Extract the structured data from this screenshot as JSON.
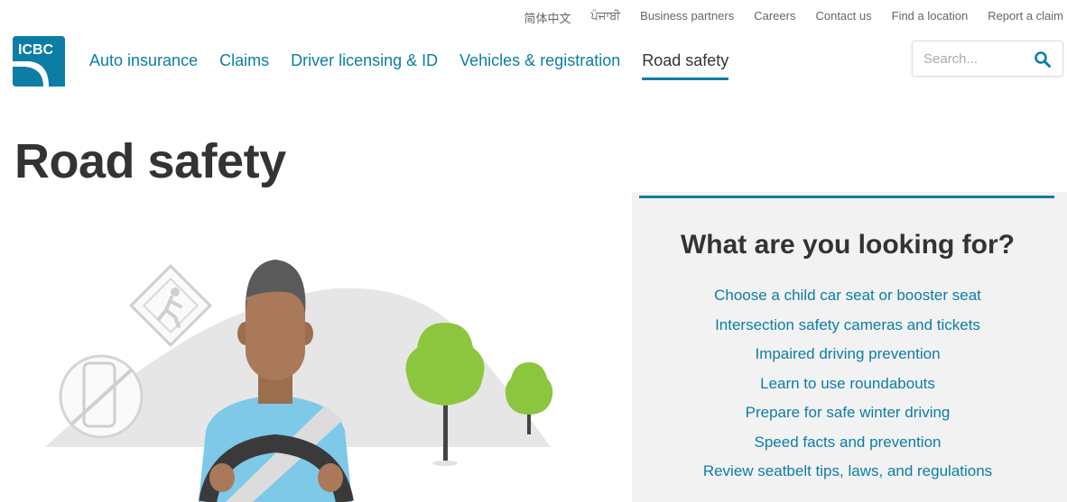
{
  "utility_nav": {
    "lang_chinese": "简体中文",
    "lang_punjabi": "ਪੰਜਾਬੀ",
    "business_partners": "Business partners",
    "careers": "Careers",
    "contact_us": "Contact us",
    "find_location": "Find a location",
    "report_claim": "Report a claim"
  },
  "logo": {
    "text": "ICBC",
    "color": "#0c7ea6"
  },
  "main_nav": {
    "items": [
      {
        "label": "Auto insurance"
      },
      {
        "label": "Claims"
      },
      {
        "label": "Driver licensing & ID"
      },
      {
        "label": "Vehicles & registration"
      },
      {
        "label": "Road safety"
      }
    ],
    "active_index": 4
  },
  "search": {
    "placeholder": "Search...",
    "icon": "search-icon"
  },
  "page": {
    "title": "Road safety"
  },
  "looking_for": {
    "title": "What are you looking for?",
    "links": [
      "Choose a child car seat or booster seat",
      "Intersection safety cameras and tickets",
      "Impaired driving prevention",
      "Learn to use roundabouts",
      "Prepare for safe winter driving",
      "Speed facts and prevention",
      "Review seatbelt tips, laws, and regulations"
    ]
  },
  "colors": {
    "accent": "#0c7ea6",
    "text": "#333333",
    "panel_bg": "#f2f2f2",
    "tree_green": "#8cc63f"
  }
}
